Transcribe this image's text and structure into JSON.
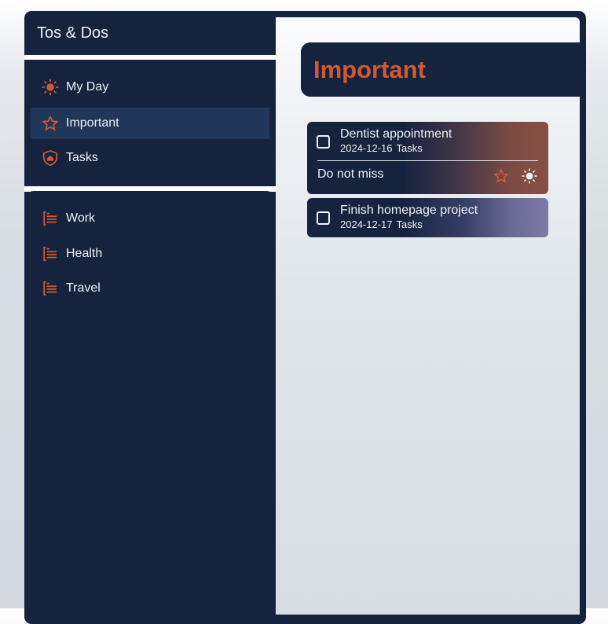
{
  "app": {
    "title": "Tos & Dos"
  },
  "sidebar": {
    "nav": [
      {
        "label": "My Day",
        "icon": "sun-icon"
      },
      {
        "label": "Important",
        "icon": "star-icon",
        "active": true
      },
      {
        "label": "Tasks",
        "icon": "home-shield-icon"
      }
    ],
    "lists": [
      {
        "label": "Work",
        "icon": "list-icon"
      },
      {
        "label": "Health",
        "icon": "list-icon"
      },
      {
        "label": "Travel",
        "icon": "list-icon"
      }
    ]
  },
  "main": {
    "title": "Important",
    "tasks": [
      {
        "name": "Dentist appointment",
        "date": "2024-12-16",
        "list": "Tasks",
        "note": "Do not miss",
        "checked": false
      },
      {
        "name": "Finish homepage project",
        "date": "2024-12-17",
        "list": "Tasks",
        "checked": false
      }
    ]
  },
  "colors": {
    "navy": "#16233f",
    "accent": "#d15a36",
    "active_item": "#213759",
    "text": "#eef1f6"
  }
}
